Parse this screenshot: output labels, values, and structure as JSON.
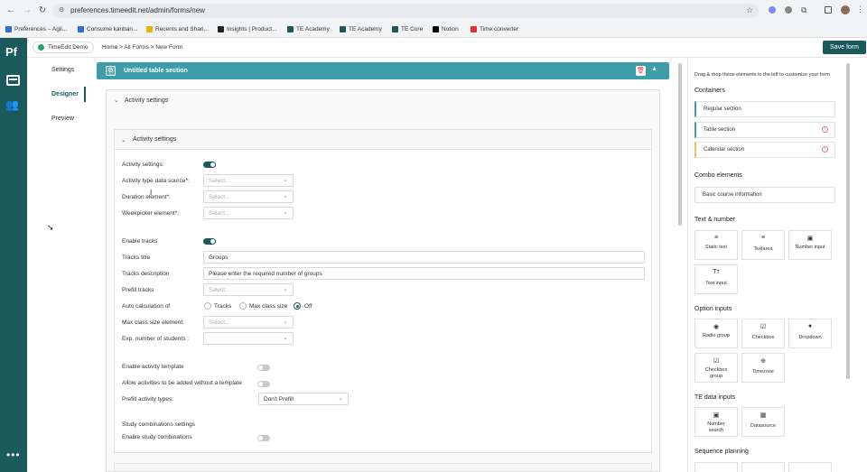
{
  "browser": {
    "url": "preferences.timeedit.net/admin/forms/new",
    "bookmarks": [
      {
        "label": "Preferences – Agil...",
        "color": "#2f6fd6"
      },
      {
        "label": "Consume kanban...",
        "color": "#2f6fd6"
      },
      {
        "label": "Recents and Shari...",
        "color": "#f0b400"
      },
      {
        "label": "Insights | Product...",
        "color": "#222"
      },
      {
        "label": "TE Academy",
        "color": "#1b5a5c"
      },
      {
        "label": "TE Academy",
        "color": "#1b5a5c"
      },
      {
        "label": "TE Core",
        "color": "#1b5a5c"
      },
      {
        "label": "Notion",
        "color": "#000"
      },
      {
        "label": "Time converter",
        "color": "#d33"
      }
    ]
  },
  "app": {
    "logo": "Pf",
    "org_name": "TimeEdit Demo",
    "breadcrumb": "Home > All Forms > New Form",
    "save_label": "Save form",
    "accent": "#1b5a5c"
  },
  "left_nav": {
    "items": [
      "Settings",
      "Designer",
      "Preview"
    ],
    "active": "Designer"
  },
  "section": {
    "title": "Untitled table section",
    "color": "#3d9eaa"
  },
  "activity": {
    "outer_title": "Activity settings",
    "inner_title": "Activity settings",
    "activity_settings_label": "Activity settings:",
    "activity_settings_on": true,
    "type_source_label": "Activity type data source*:",
    "duration_label": "Duration element*:",
    "weekpicker_label": "Weekpicker element*:",
    "select_placeholder": "Select...",
    "enable_tracks_label": "Enable tracks",
    "enable_tracks_on": true,
    "tracks_title_label": "Tracks title",
    "tracks_title_value": "Groups",
    "tracks_desc_label": "Tracks description",
    "tracks_desc_value": "Please enter the required number of groups",
    "prefill_tracks_label": "Prefill tracks",
    "auto_calc_label": "Auto calculation of",
    "auto_calc_options": [
      "Tracks",
      "Max class size",
      "Off"
    ],
    "auto_calc_selected": "Off",
    "max_class_label": "Max class size element:",
    "exp_students_label": "Exp. number of students :",
    "enable_template_label": "Enable activity template",
    "allow_without_template_label": "Allow activities to be added without a template",
    "prefill_types_label": "Prefill activity types:",
    "prefill_types_value": "Don't Prefill",
    "study_comb_heading": "Study combinations settings",
    "enable_study_comb_label": "Enable study combinations"
  },
  "right_panel": {
    "instruction": "Drag & drop these elements to the left to customize your form",
    "containers_heading": "Containers",
    "containers": [
      {
        "label": "Regular section",
        "border": "#3d9eaa",
        "warn": false
      },
      {
        "label": "Table section",
        "border": "#3d9eaa",
        "warn": true
      },
      {
        "label": "Calendar section",
        "border": "#f0c060",
        "warn": true
      }
    ],
    "combo_heading": "Combo elements",
    "combo_items": [
      "Basic course information"
    ],
    "text_number_heading": "Text & number",
    "text_number": [
      {
        "label": "Static text",
        "icon": "static-text-icon",
        "glyph": "≡"
      },
      {
        "label": "Textarea",
        "icon": "textarea-icon",
        "glyph": "≡"
      },
      {
        "label": "Number input",
        "icon": "number-input-icon",
        "glyph": "▣"
      },
      {
        "label": "Text input",
        "icon": "text-input-icon",
        "glyph": "Tт"
      }
    ],
    "option_heading": "Option inputs",
    "options": [
      {
        "label": "Radio group",
        "icon": "radio-icon",
        "glyph": "◉"
      },
      {
        "label": "Checkbox",
        "icon": "checkbox-icon",
        "glyph": "☑"
      },
      {
        "label": "Dropdown",
        "icon": "dropdown-icon",
        "glyph": "●"
      },
      {
        "label": "Checkbox group",
        "icon": "checkbox-group-icon",
        "glyph": "☑"
      },
      {
        "label": "Timezone",
        "icon": "globe-icon",
        "glyph": "⊕"
      }
    ],
    "te_heading": "TE data inputs",
    "te_inputs": [
      {
        "label": "Number search",
        "icon": "number-search-icon",
        "glyph": "▣"
      },
      {
        "label": "Datasource",
        "icon": "datasource-icon",
        "glyph": "▦"
      }
    ],
    "sequence_heading": "Sequence planning"
  }
}
